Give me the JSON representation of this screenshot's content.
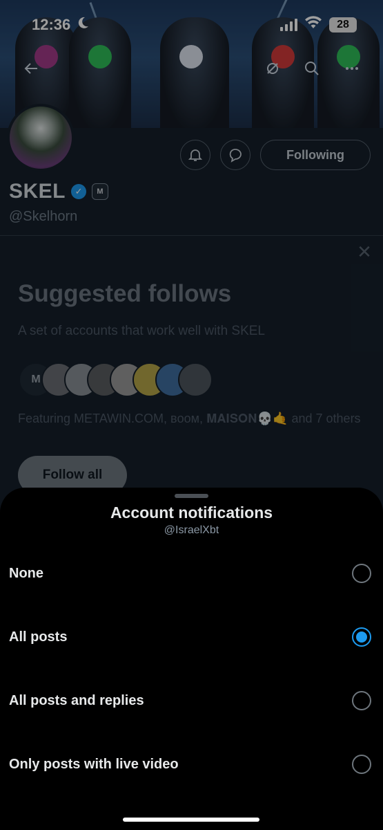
{
  "status_bar": {
    "time": "12:36",
    "battery": "28",
    "icons": [
      "moon-icon",
      "signal-icon",
      "wifi-icon",
      "battery-icon"
    ]
  },
  "top_nav": {
    "icons": [
      "back-arrow-icon",
      "no-mute-icon",
      "search-icon",
      "more-icon"
    ]
  },
  "profile": {
    "display_name": "SKEL",
    "handle": "@Skelhorn",
    "affiliate_badge": "M",
    "following_label": "Following",
    "action_icons": [
      "notify-bell-icon",
      "message-icon"
    ]
  },
  "suggested": {
    "title": "Suggested follows",
    "subtitle": "A set of accounts that work well with SKEL",
    "featuring_text": "Featuring METAWIN.COM, ʙᴏᴏᴍ, 𝐌𝐀𝐈𝐒𝐎𝐍💀🤙 and 7 others",
    "follow_all_label": "Follow all",
    "avatar_count": 8
  },
  "sheet": {
    "title": "Account notifications",
    "subtitle": "@IsraelXbt",
    "options": [
      {
        "label": "None",
        "selected": false
      },
      {
        "label": "All posts",
        "selected": true
      },
      {
        "label": "All posts and replies",
        "selected": false
      },
      {
        "label": "Only posts with live video",
        "selected": false
      }
    ]
  },
  "colors": {
    "accent": "#1d9bf0",
    "sheet_bg": "#000000",
    "page_bg": "#15202b"
  }
}
